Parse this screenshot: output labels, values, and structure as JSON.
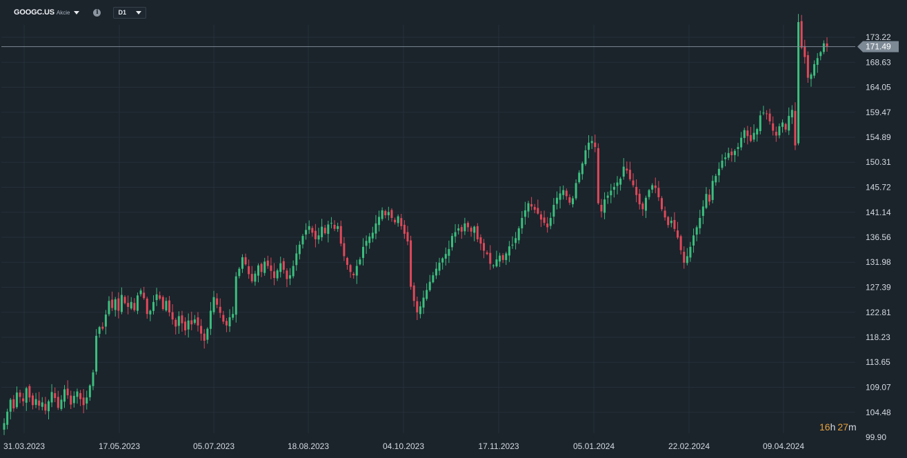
{
  "header": {
    "symbol": "GOOGC.US",
    "asset_type": "Akcie",
    "timeframe": "D1"
  },
  "countdown": {
    "hours": "16",
    "h_unit": "h",
    "minutes": "27",
    "m_unit": "m"
  },
  "colors": {
    "background": "#1b232b",
    "grid": "#253039",
    "up": "#3bbf7e",
    "down": "#e0495a",
    "price_line": "#7d8a96",
    "price_tag": "#7d8a96",
    "countdown": "#e7a23b"
  },
  "chart_data": {
    "type": "candlestick",
    "title": "",
    "current_price": 171.49,
    "ylim": [
      99.9,
      177.8
    ],
    "y_ticks": [
      173.22,
      168.63,
      164.05,
      159.47,
      154.89,
      150.31,
      145.72,
      141.14,
      136.56,
      131.98,
      127.39,
      122.81,
      118.23,
      113.65,
      109.07,
      104.48,
      99.9
    ],
    "x_ticks": [
      "31.03.2023",
      "17.05.2023",
      "05.07.2023",
      "18.08.2023",
      "04.10.2023",
      "17.11.2023",
      "05.01.2024",
      "22.02.2024",
      "09.04.2024"
    ],
    "grid": true,
    "closes": [
      102.5,
      104.6,
      106.8,
      105.2,
      108.1,
      107.3,
      106.5,
      108.9,
      107.2,
      105.8,
      106.9,
      105.7,
      106.3,
      104.8,
      106.5,
      108.2,
      107.1,
      105.3,
      106.8,
      108.7,
      107.6,
      105.9,
      107.5,
      108.3,
      106.9,
      105.8,
      107.2,
      109.4,
      111.8,
      118.5,
      120.1,
      119.8,
      122.4,
      124.9,
      123.6,
      125.2,
      123.1,
      126.0,
      124.5,
      123.8,
      124.7,
      123.2,
      125.9,
      126.8,
      125.4,
      122.5,
      123.1,
      124.7,
      126.1,
      125.3,
      123.4,
      124.9,
      122.8,
      121.5,
      120.2,
      122.1,
      120.8,
      119.5,
      121.3,
      120.6,
      121.5,
      120.4,
      118.9,
      117.6,
      119.8,
      123.1,
      125.6,
      124.2,
      122.7,
      121.1,
      120.4,
      121.9,
      122.5,
      129.4,
      130.8,
      132.9,
      131.6,
      129.8,
      128.5,
      129.9,
      131.4,
      130.2,
      132.1,
      131.3,
      130.4,
      129.1,
      130.5,
      131.8,
      130.6,
      128.9,
      129.6,
      131.3,
      133.6,
      135.2,
      136.8,
      137.9,
      138.6,
      137.4,
      136.2,
      136.9,
      138.5,
      137.3,
      138.9,
      139.2,
      138.1,
      138.6,
      135.4,
      133.1,
      131.5,
      130.2,
      129.6,
      131.3,
      132.5,
      134.8,
      135.9,
      136.7,
      137.4,
      139.1,
      140.3,
      141.5,
      140.6,
      141.2,
      140.1,
      139.3,
      140.4,
      138.6,
      137.2,
      135.8,
      127.5,
      124.9,
      122.8,
      123.9,
      125.5,
      126.9,
      128.4,
      129.6,
      130.8,
      131.9,
      132.7,
      133.5,
      134.4,
      136.8,
      137.5,
      138.2,
      137.6,
      139.1,
      138.4,
      137.6,
      138.5,
      136.2,
      135.4,
      134.1,
      133.5,
      131.7,
      131.4,
      132.5,
      133.2,
      132.4,
      133.6,
      134.9,
      135.2,
      136.4,
      138.2,
      140.1,
      141.5,
      142.8,
      142.2,
      141.6,
      140.9,
      139.8,
      139.2,
      138.4,
      140.1,
      142.5,
      143.8,
      144.6,
      145.2,
      144.1,
      142.9,
      143.7,
      146.5,
      148.4,
      150.1,
      152.5,
      153.9,
      154.2,
      153.1,
      142.8,
      141.3,
      143.5,
      144.2,
      145.1,
      145.8,
      146.6,
      147.3,
      149.5,
      148.8,
      147.2,
      146.1,
      144.3,
      142.6,
      141.7,
      143.8,
      145.2,
      146.1,
      145.6,
      143.9,
      141.7,
      140.2,
      138.8,
      139.6,
      138.1,
      136.5,
      134.2,
      131.9,
      133.1,
      134.8,
      136.9,
      138.4,
      140.1,
      142.2,
      144.5,
      143.1,
      146.9,
      147.8,
      149.1,
      150.6,
      151.2,
      152.0,
      151.6,
      152.4,
      153.1,
      154.8,
      156.2,
      155.1,
      154.2,
      155.7,
      156.4,
      158.9,
      159.4,
      159.2,
      157.8,
      156.1,
      155.2,
      156.9,
      157.6,
      156.3,
      158.8,
      159.9,
      153.4,
      176.0,
      171.3,
      169.6,
      165.8,
      166.4,
      168.3,
      169.4,
      170.5,
      172.1,
      171.49
    ],
    "opens_from_prev_close": true
  }
}
